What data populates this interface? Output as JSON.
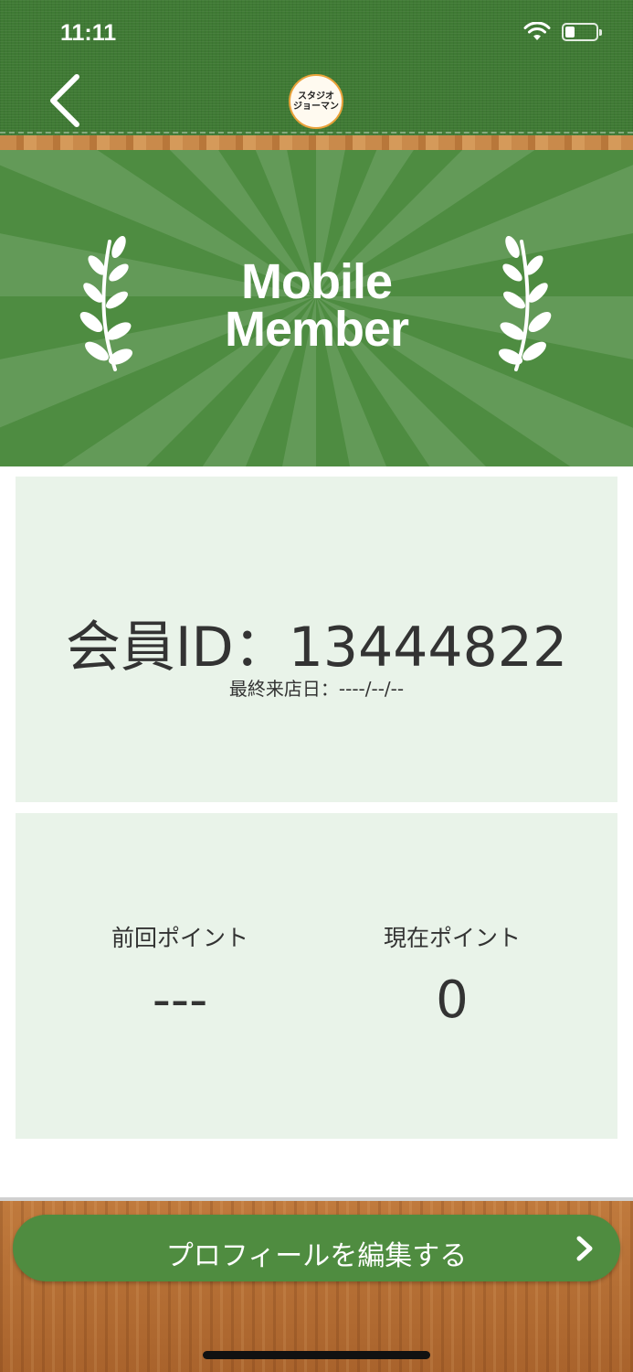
{
  "status_bar": {
    "time": "11:11",
    "battery_level": 0.3,
    "wifi_icon": "wifi-icon",
    "battery_icon": "battery-icon"
  },
  "header": {
    "back_icon": "chevron-left-icon",
    "logo_line1": "スタジオ",
    "logo_line2": "ジョーマン"
  },
  "banner": {
    "title_line1": "Mobile",
    "title_line2": "Member",
    "laurel_icon": "laurel-icon"
  },
  "member_card": {
    "member_id": "会員ID：13444822",
    "last_visit": "最終来店日：----/--/--"
  },
  "points_card": {
    "previous_label": "前回ポイント",
    "previous_value": "---",
    "current_label": "現在ポイント",
    "current_value": "0"
  },
  "footer": {
    "edit_profile_label": "プロフィールを編集する",
    "chevron_icon": "chevron-right-icon"
  },
  "colors": {
    "header_green": "#3f7a34",
    "banner_green": "#4e8c41",
    "card_background": "#e9f3e9",
    "button_green": "#4f8c40",
    "wood": "#b56f33"
  }
}
